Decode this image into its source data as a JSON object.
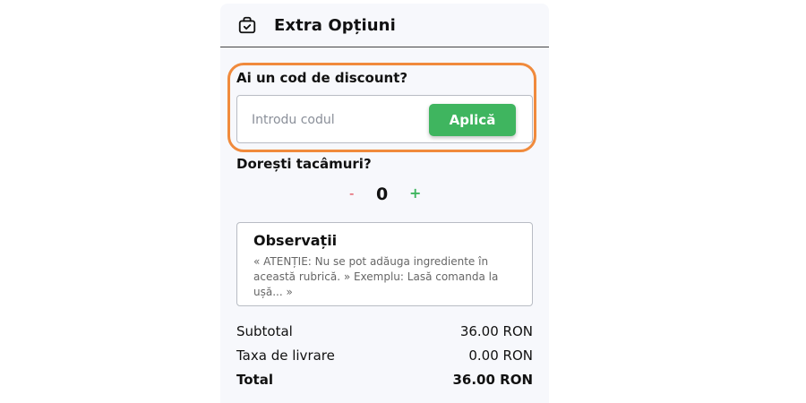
{
  "header": {
    "title": "Extra Opțiuni",
    "icon": "bag-check-icon"
  },
  "discount": {
    "label": "Ai un cod de discount?",
    "placeholder": "Introdu codul",
    "value": "",
    "apply_label": "Aplică",
    "highlight_color": "#f08a3c"
  },
  "cutlery": {
    "label": "Dorești tacâmuri?",
    "minus": "-",
    "count": "0",
    "plus": "+"
  },
  "notes": {
    "title": "Observații",
    "placeholder": "« ATENȚIE: Nu se pot adăuga ingrediente în această rubrică. » Exemplu: Lasă comanda la ușă... »"
  },
  "summary": {
    "subtotal_label": "Subtotal",
    "subtotal_value": "36.00 RON",
    "delivery_label": "Taxa de livrare",
    "delivery_value": "0.00 RON",
    "total_label": "Total",
    "total_value": "36.00 RON"
  },
  "colors": {
    "accent_green": "#3fb55f",
    "minus_red": "#e0404e",
    "panel_bg": "#f7f8fc"
  }
}
